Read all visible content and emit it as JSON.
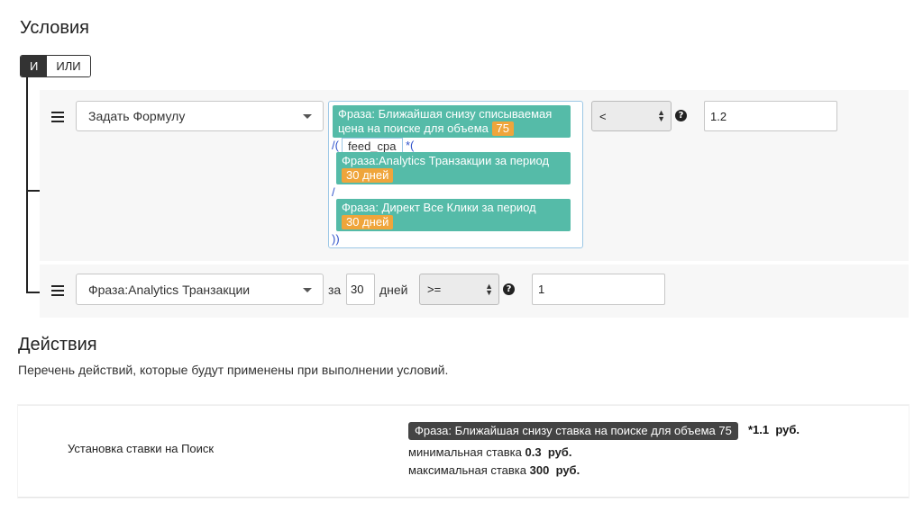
{
  "conditions": {
    "title": "Условия",
    "logic": {
      "and_label": "И",
      "or_label": "ИЛИ",
      "active": "and"
    },
    "rule1": {
      "metric_select": "Задать Формулу",
      "formula": {
        "chip1_text": "Фраза: Ближайшая снизу списываемая цена на поиске для объема",
        "chip1_badge": "75",
        "open": "/(",
        "variable": "feed_cpa",
        "mult": "*(",
        "chip2_text": "Фраза:Analytics Транзакции за период",
        "chip2_badge": "30 дней",
        "div": "/",
        "chip3_text": "Фраза: Директ Все Клики за период",
        "chip3_badge": "30 дней",
        "close": "))"
      },
      "operator": "<",
      "value": "1.2",
      "help_icon": "question-circle-icon"
    },
    "rule2": {
      "metric_select": "Фраза:Analytics Транзакции",
      "za_label": "за",
      "period_value": "30",
      "days_label": "дней",
      "operator": ">=",
      "value": "1",
      "help_icon": "question-circle-icon"
    }
  },
  "actions": {
    "title": "Действия",
    "description": "Перечень действий, которые будут применены при выполнении условий.",
    "item": {
      "name": "Установка ставки на Поиск",
      "phrase_tag": "Фраза: Ближайшая снизу ставка на поиске для объема 75",
      "multiplier": "*1.1",
      "currency": "руб.",
      "min_label": "минимальная ставка",
      "min_value": "0.3",
      "max_label": "максимальная ставка",
      "max_value": "300"
    }
  },
  "colors": {
    "chip": "#55bba8",
    "badge": "#efa53b",
    "formula_border": "#9cc7e6",
    "operator_text": "#3355cc"
  }
}
